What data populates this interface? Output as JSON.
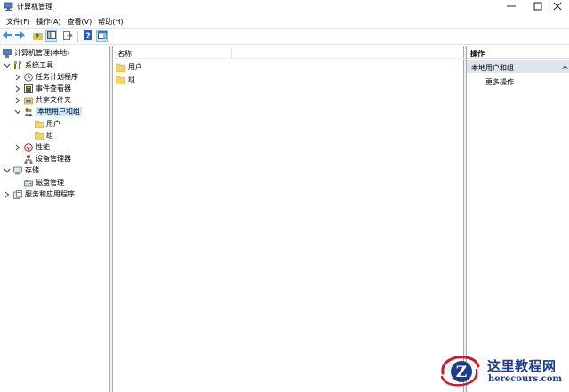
{
  "window": {
    "title": "计算机管理",
    "controls": {
      "minimize": "minimize-icon",
      "maximize": "maximize-icon",
      "close": "close-icon"
    }
  },
  "menubar": [
    {
      "label": "文件(F)"
    },
    {
      "label": "操作(A)"
    },
    {
      "label": "查看(V)"
    },
    {
      "label": "帮助(H)"
    }
  ],
  "toolbar": [
    "back-icon",
    "forward-icon",
    "up-folder-icon",
    "show-hide-tree-icon",
    "export-list-icon",
    "help-icon",
    "properties-icon"
  ],
  "tree": {
    "root": "计算机管理(本地)",
    "system_tools": "系统工具",
    "task_scheduler": "任务计划程序",
    "event_viewer": "事件查看器",
    "shared_folders": "共享文件夹",
    "local_users_groups": "本地用户和组",
    "users": "用户",
    "groups": "组",
    "performance": "性能",
    "device_manager": "设备管理器",
    "storage": "存储",
    "disk_management": "磁盘管理",
    "services_apps": "服务和应用程序"
  },
  "list": {
    "column_name": "名称",
    "items": [
      "用户",
      "组"
    ]
  },
  "actions": {
    "header": "操作",
    "section": "本地用户和组",
    "more": "更多操作"
  },
  "watermark": {
    "logo_letter": "Z",
    "title": "这里教程网",
    "url": "herecours.com"
  },
  "colors": {
    "selection": "#cce8ff",
    "action_section_bg": "#dfe5ee",
    "folder": "#e8c15a",
    "watermark_blue": "#1d3d86",
    "watermark_red": "#c81e2a"
  }
}
